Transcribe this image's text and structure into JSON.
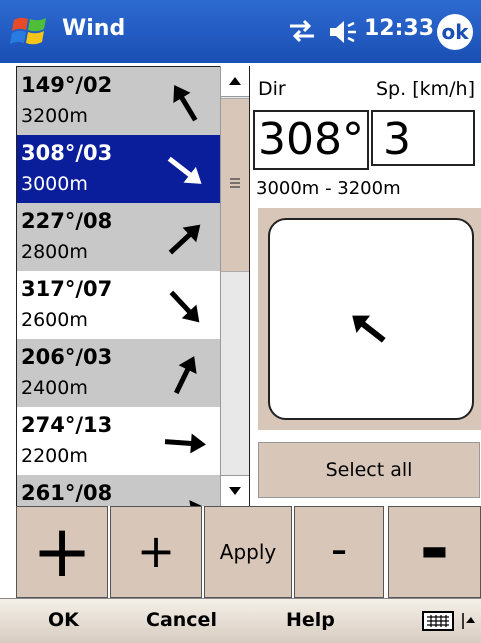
{
  "title": "Wind",
  "clock": "12:33",
  "ok_label": "ok",
  "list": [
    {
      "dir": "149°/02",
      "alt": "3200m",
      "style": "gray",
      "arrow_deg": 149
    },
    {
      "dir": "308°/03",
      "alt": "3000m",
      "style": "sel",
      "arrow_deg": 308
    },
    {
      "dir": "227°/08",
      "alt": "2800m",
      "style": "gray",
      "arrow_deg": 227
    },
    {
      "dir": "317°/07",
      "alt": "2600m",
      "style": "white",
      "arrow_deg": 317
    },
    {
      "dir": "206°/03",
      "alt": "2400m",
      "style": "gray",
      "arrow_deg": 206
    },
    {
      "dir": "274°/13",
      "alt": "2200m",
      "style": "white",
      "arrow_deg": 274
    },
    {
      "dir": "261°/08",
      "alt": "",
      "style": "gray",
      "arrow_deg": 261
    }
  ],
  "panel": {
    "dir_label": "Dir",
    "speed_label": "Sp. [km/h]",
    "dir_value": "308°",
    "speed_value": "3",
    "range": "3000m - 3200m",
    "select_all": "Select all"
  },
  "buttons": {
    "big_plus": "+",
    "plus": "+",
    "apply": "Apply",
    "minus": "-",
    "big_minus": "-"
  },
  "menu": {
    "ok": "OK",
    "cancel": "Cancel",
    "help": "Help"
  }
}
